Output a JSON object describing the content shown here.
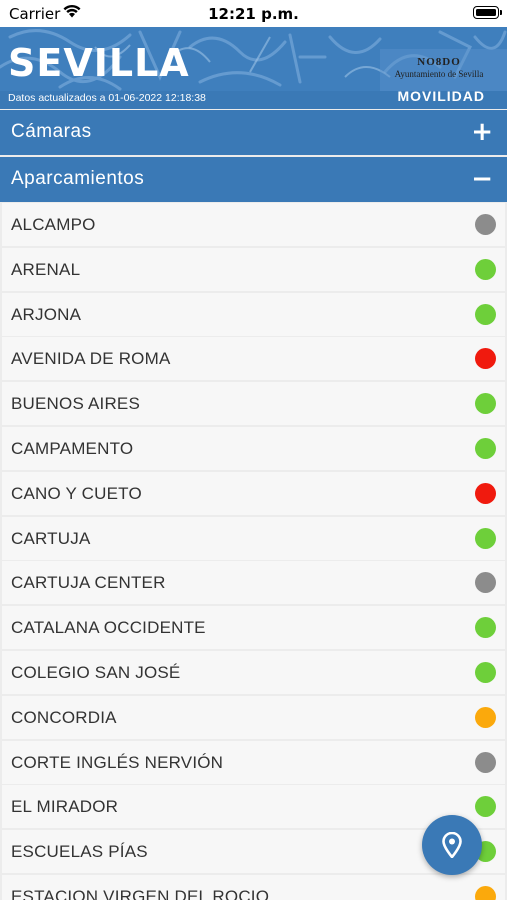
{
  "status_bar": {
    "carrier": "Carrier",
    "time": "12:21 p.m."
  },
  "header": {
    "city": "SEVILLA",
    "logo_mark": "NO8DO",
    "logo_text": "Ayuntamiento de Sevilla",
    "updated": "Datos actualizados a 01-06-2022 12:18:38",
    "section": "MOVILIDAD"
  },
  "accordion": {
    "camaras": {
      "label": "Cámaras",
      "toggle": "+"
    },
    "aparcamientos": {
      "label": "Aparcamientos",
      "toggle": "−"
    }
  },
  "colors": {
    "primary": "#3a79b6",
    "green": "#6ecf3a",
    "red": "#f01a0e",
    "gray": "#8c8c8c",
    "orange": "#fba90c"
  },
  "parkings": [
    {
      "name": "ALCAMPO",
      "status": "gray"
    },
    {
      "name": "ARENAL",
      "status": "green"
    },
    {
      "name": "ARJONA",
      "status": "green"
    },
    {
      "name": "AVENIDA DE ROMA",
      "status": "red"
    },
    {
      "name": "BUENOS AIRES",
      "status": "green"
    },
    {
      "name": "CAMPAMENTO",
      "status": "green"
    },
    {
      "name": "CANO Y CUETO",
      "status": "red"
    },
    {
      "name": "CARTUJA",
      "status": "green"
    },
    {
      "name": "CARTUJA CENTER",
      "status": "gray"
    },
    {
      "name": "CATALANA OCCIDENTE",
      "status": "green"
    },
    {
      "name": "COLEGIO SAN JOSÉ",
      "status": "green"
    },
    {
      "name": "CONCORDIA",
      "status": "orange"
    },
    {
      "name": "CORTE INGLÉS NERVIÓN",
      "status": "gray"
    },
    {
      "name": "EL MIRADOR",
      "status": "green"
    },
    {
      "name": "ESCUELAS PÍAS",
      "status": "green"
    },
    {
      "name": "ESTACION VIRGEN DEL ROCIO",
      "status": "orange"
    }
  ],
  "fab": {
    "icon": "map-pin-icon"
  }
}
